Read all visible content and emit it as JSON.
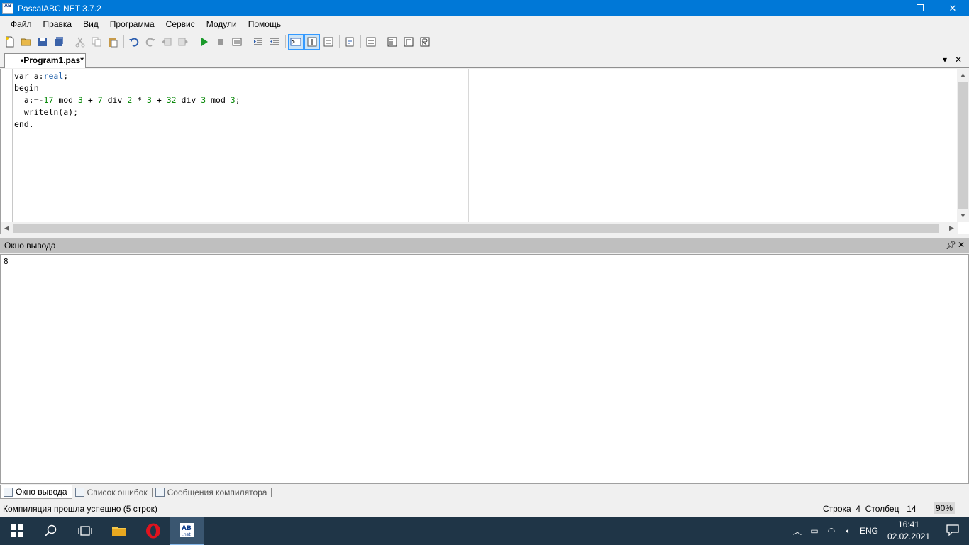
{
  "window": {
    "title": "PascalABC.NET 3.7.2",
    "app_icon_text": "AB",
    "controls": [
      "–",
      "❐",
      "✕"
    ]
  },
  "menu": [
    "Файл",
    "Правка",
    "Вид",
    "Программа",
    "Сервис",
    "Модули",
    "Помощь"
  ],
  "document_tab": {
    "label": "•Program1.pas*"
  },
  "editor": {
    "lines": [
      [
        {
          "t": "var a:",
          "c": "kw"
        },
        {
          "t": "real",
          "c": "type"
        },
        {
          "t": ";",
          "c": "kw"
        }
      ],
      [
        {
          "t": "begin",
          "c": "kw"
        }
      ],
      [
        {
          "t": "  a:=-",
          "c": "kw"
        },
        {
          "t": "17",
          "c": "num"
        },
        {
          "t": " mod ",
          "c": "kw"
        },
        {
          "t": "3",
          "c": "num"
        },
        {
          "t": " + ",
          "c": "kw"
        },
        {
          "t": "7",
          "c": "num"
        },
        {
          "t": " div ",
          "c": "kw"
        },
        {
          "t": "2",
          "c": "num"
        },
        {
          "t": " * ",
          "c": "kw"
        },
        {
          "t": "3",
          "c": "num"
        },
        {
          "t": " + ",
          "c": "kw"
        },
        {
          "t": "32",
          "c": "num"
        },
        {
          "t": " div ",
          "c": "kw"
        },
        {
          "t": "3",
          "c": "num"
        },
        {
          "t": " mod ",
          "c": "kw"
        },
        {
          "t": "3",
          "c": "num"
        },
        {
          "t": ";",
          "c": "kw"
        }
      ],
      [
        {
          "t": "  writeln(a);",
          "c": "kw"
        }
      ],
      [
        {
          "t": "end.",
          "c": "kw"
        }
      ]
    ]
  },
  "output_panel": {
    "title": "Окно вывода",
    "content": "8"
  },
  "bottom_tabs": [
    "Окно вывода",
    "Список ошибок",
    "Сообщения компилятора"
  ],
  "status": {
    "message": "Компиляция прошла успешно (5 строк)",
    "row_label": "Строка",
    "row_value": "4",
    "col_label": "Столбец",
    "col_value": "14",
    "zoom": "90%"
  },
  "taskbar": {
    "language": "ENG",
    "time": "16:41",
    "date": "02.02.2021"
  }
}
